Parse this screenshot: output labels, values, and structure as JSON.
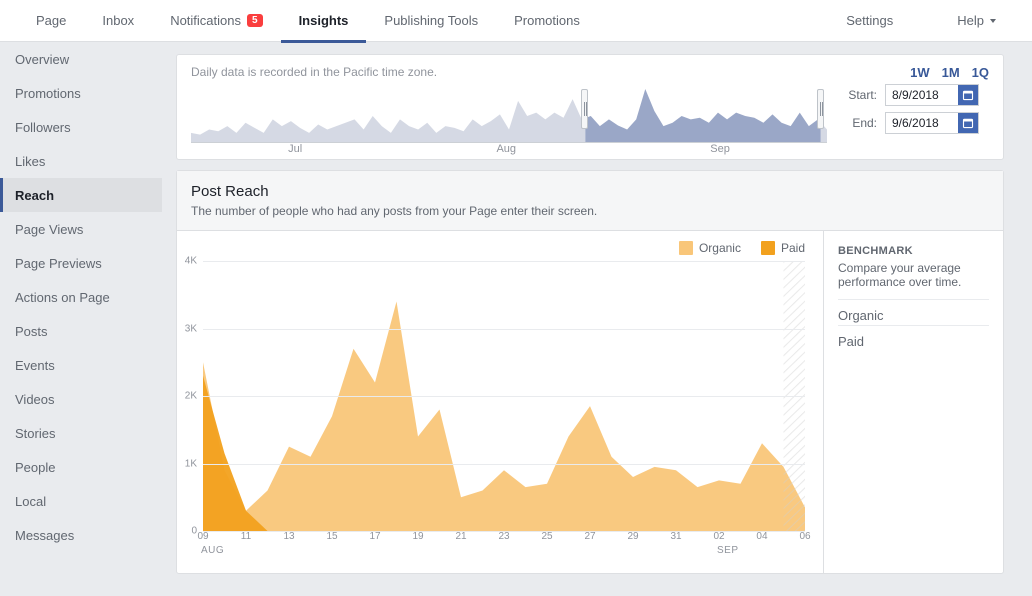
{
  "topnav": {
    "left": [
      {
        "label": "Page"
      },
      {
        "label": "Inbox"
      },
      {
        "label": "Notifications",
        "badge": "5"
      },
      {
        "label": "Insights",
        "active": true
      },
      {
        "label": "Publishing Tools"
      },
      {
        "label": "Promotions"
      }
    ],
    "right": [
      {
        "label": "Settings"
      },
      {
        "label": "Help",
        "caret": true
      }
    ]
  },
  "sidebar": {
    "items": [
      "Overview",
      "Promotions",
      "Followers",
      "Likes",
      "Reach",
      "Page Views",
      "Page Previews",
      "Actions on Page",
      "Posts",
      "Events",
      "Videos",
      "Stories",
      "People",
      "Local",
      "Messages"
    ],
    "active_index": 4
  },
  "overview": {
    "note": "Daily data is recorded in the Pacific time zone.",
    "range_buttons": [
      "1W",
      "1M",
      "1Q"
    ],
    "start_label": "Start:",
    "end_label": "End:",
    "start_value": "8/9/2018",
    "end_value": "9/6/2018",
    "months": [
      "Jul",
      "Aug",
      "Sep"
    ]
  },
  "reach": {
    "title": "Post Reach",
    "subtitle": "The number of people who had any posts from your Page enter their screen.",
    "legend": {
      "organic": "Organic",
      "paid": "Paid"
    },
    "benchmark": {
      "title": "BENCHMARK",
      "desc": "Compare your average performance over time.",
      "items": [
        "Organic",
        "Paid"
      ]
    }
  },
  "chart_data": {
    "type": "area",
    "title": "Post Reach",
    "xlabel": "",
    "ylabel": "",
    "ylim": [
      0,
      4000
    ],
    "y_ticks": [
      "0",
      "1K",
      "2K",
      "3K",
      "4K"
    ],
    "x_days": [
      "09",
      "11",
      "13",
      "15",
      "17",
      "19",
      "21",
      "23",
      "25",
      "27",
      "29",
      "31",
      "02",
      "04",
      "06"
    ],
    "x_month_labels": [
      {
        "label": "AUG",
        "at": "09"
      },
      {
        "label": "SEP",
        "at": "02"
      }
    ],
    "series": [
      {
        "name": "Organic",
        "color": "#f9c679",
        "values": [
          2500,
          900,
          300,
          600,
          1250,
          1100,
          1700,
          2700,
          2200,
          3400,
          1400,
          1800,
          500,
          600,
          900,
          650,
          700,
          1400,
          1850,
          1100,
          800,
          950,
          900,
          650,
          750,
          700,
          1300,
          950,
          350
        ]
      },
      {
        "name": "Paid",
        "color": "#f2a11e",
        "values": [
          2300,
          1150,
          300,
          0,
          0,
          0,
          0,
          0,
          0,
          0,
          0,
          0,
          0,
          0,
          0,
          0,
          0,
          0,
          0,
          0,
          0,
          0,
          0,
          0,
          0,
          0,
          0,
          0,
          0
        ]
      }
    ]
  },
  "mini_chart": {
    "values": [
      300,
      250,
      400,
      350,
      500,
      300,
      600,
      450,
      300,
      700,
      500,
      650,
      450,
      300,
      550,
      400,
      500,
      600,
      700,
      400,
      800,
      500,
      300,
      700,
      500,
      400,
      600,
      300,
      500,
      450,
      350,
      700,
      500,
      650,
      850,
      400,
      1250,
      800,
      900,
      700,
      900,
      750,
      1300,
      700,
      800,
      500,
      700,
      520,
      400,
      700,
      1600,
      950,
      500,
      600,
      800,
      700,
      750,
      600,
      900,
      700,
      900,
      800,
      750,
      600,
      850,
      600,
      500,
      900,
      500,
      700,
      400
    ],
    "selection": {
      "start_pct": 62,
      "end_pct": 99
    }
  }
}
